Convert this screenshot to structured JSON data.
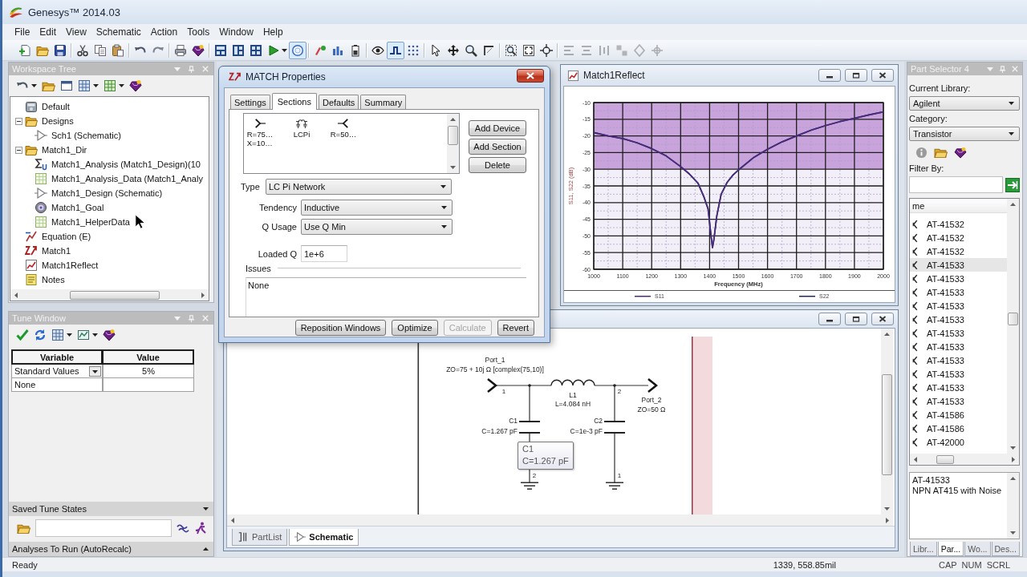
{
  "app": {
    "title": "Genesys™ 2014.03"
  },
  "menu": [
    "File",
    "Edit",
    "View",
    "Schematic",
    "Action",
    "Tools",
    "Window",
    "Help"
  ],
  "toolbar": {
    "toggle_buttons": [
      {
        "pressed": true
      },
      {
        "pressed": true
      }
    ],
    "arrange_buttons": {
      "disabled": true
    }
  },
  "workspace_tree": {
    "title": "Workspace Tree",
    "items": [
      {
        "label": "Default",
        "kind": "workspace"
      },
      {
        "label": "Designs",
        "kind": "folder",
        "expanded": true,
        "children": [
          {
            "label": "Sch1 (Schematic)",
            "kind": "schematic"
          }
        ]
      },
      {
        "label": "Match1_Dir",
        "kind": "folder",
        "expanded": true,
        "children": [
          {
            "label": "Match1_Analysis (Match1_Design)(10",
            "kind": "analysis"
          },
          {
            "label": "Match1_Analysis_Data (Match1_Analy",
            "kind": "dataset"
          },
          {
            "label": "Match1_Design (Schematic)",
            "kind": "schematic"
          },
          {
            "label": "Match1_Goal",
            "kind": "goal"
          },
          {
            "label": "Match1_HelperData",
            "kind": "dataset"
          }
        ]
      },
      {
        "label": "Equation (E)",
        "kind": "equation"
      },
      {
        "label": "Match1",
        "kind": "match"
      },
      {
        "label": "Match1Reflect",
        "kind": "graph"
      },
      {
        "label": "Notes",
        "kind": "notes"
      }
    ]
  },
  "tune_window": {
    "title": "Tune Window",
    "columns": [
      "Variable",
      "Value"
    ],
    "rows": [
      {
        "kind": "dropdown",
        "variable": "Standard Values",
        "value": "5%"
      },
      {
        "kind": "text",
        "variable": "None"
      }
    ]
  },
  "saved_tune_states": {
    "title": "Saved Tune States"
  },
  "analyses_to_run": {
    "title": "Analyses To Run (AutoRecalc)"
  },
  "match_properties": {
    "title": "MATCH Properties",
    "tabs": [
      {
        "label": "Settings",
        "selected": false
      },
      {
        "label": "Sections",
        "selected": true
      },
      {
        "label": "Defaults",
        "selected": false
      },
      {
        "label": "Summary",
        "selected": false
      }
    ],
    "sections": [
      {
        "kind": "source",
        "lines": [
          "R=75…",
          "X=10…"
        ]
      },
      {
        "kind": "network",
        "lines": [
          "LCPi"
        ]
      },
      {
        "kind": "load",
        "lines": [
          "R=50…"
        ]
      }
    ],
    "section_buttons": [
      {
        "label": "Add Device"
      },
      {
        "label": "Add Section"
      },
      {
        "label": "Delete"
      }
    ],
    "fields": [
      {
        "kind": "dropdown",
        "label": "Type",
        "value": "LC Pi Network"
      },
      {
        "kind": "dropdown",
        "label": "Tendency",
        "value": "Inductive"
      },
      {
        "kind": "dropdown",
        "label": "Q Usage",
        "value": "Use Q Min"
      },
      {
        "kind": "text",
        "label": "Loaded Q",
        "value": "1e+6"
      }
    ],
    "issues": {
      "label": "Issues",
      "text": "None"
    },
    "buttons": [
      {
        "label": "Reposition Windows",
        "disabled": false
      },
      {
        "label": "Optimize",
        "disabled": false
      },
      {
        "label": "Calculate",
        "disabled": true
      },
      {
        "label": "Revert",
        "disabled": false
      }
    ]
  },
  "reflect_window": {
    "title": "Match1Reflect",
    "chart_data": [
      {
        "type": "line",
        "xlabel": "Frequency (MHz)",
        "ylabel": "S11, S22 (dB)",
        "x": [
          1000,
          1050,
          1100,
          1150,
          1200,
          1250,
          1300,
          1330,
          1360,
          1380,
          1395,
          1405,
          1410,
          1415,
          1425,
          1440,
          1460,
          1480,
          1500,
          1550,
          1600,
          1650,
          1700,
          1750,
          1800,
          1850,
          1900,
          1950,
          2000
        ],
        "series": [
          {
            "name": "S11",
            "color": "#4a2c7c",
            "values": [
              -19,
              -20,
              -20.8,
              -22.1,
              -23.8,
              -26,
              -29.2,
              -31.4,
              -34.2,
              -38.2,
              -42,
              -50,
              -53.5,
              -51,
              -44,
              -37.5,
              -34,
              -31.8,
              -30.2,
              -26.6,
              -24,
              -21.8,
              -20,
              -18.3,
              -16.9,
              -15.7,
              -14.7,
              -13.7,
              -12.8
            ]
          },
          {
            "name": "S22",
            "color": "#22285c",
            "values": [
              -19,
              -20,
              -20.8,
              -22.1,
              -23.8,
              -26,
              -29.2,
              -31.4,
              -34.2,
              -38.2,
              -42,
              -50,
              -53.5,
              -51,
              -44,
              -37.5,
              -34,
              -31.8,
              -30.2,
              -26.6,
              -24,
              -21.8,
              -20,
              -18.3,
              -16.9,
              -15.7,
              -14.7,
              -13.7,
              -12.8
            ]
          }
        ],
        "xlim": [
          1000,
          2000
        ],
        "ylim": [
          -60,
          -10
        ],
        "xticks": [
          1000,
          1100,
          1200,
          1300,
          1400,
          1500,
          1600,
          1700,
          1800,
          1900,
          2000
        ],
        "yticks": [
          -60,
          -55,
          -50,
          -45,
          -40,
          -35,
          -30,
          -25,
          -20,
          -15,
          -10
        ],
        "bands": [
          {
            "axis": "y",
            "from": -30,
            "to": -10,
            "color": "#c9a3dc"
          }
        ],
        "grid": true,
        "legend": "bottom"
      }
    ]
  },
  "schematic_window": {
    "schematic": {
      "ports": [
        {
          "name": "Port_1",
          "impedance": "ZO=75 + 10j Ω [complex(75,10)]",
          "pin": "1"
        },
        {
          "name": "Port_2",
          "impedance": "ZO=50 Ω"
        }
      ],
      "components": [
        {
          "kind": "inductor",
          "name": "L1",
          "value": "L=4.084 nH",
          "pin": "2"
        },
        {
          "kind": "capacitor",
          "name": "C1",
          "value": "C=1.267 pF",
          "pin": "2"
        },
        {
          "kind": "capacitor",
          "name": "C2",
          "value": "C=1e-3 pF",
          "pin": "1"
        }
      ]
    },
    "tooltip": {
      "title": "C1",
      "text": "C=1.267 pF"
    },
    "tabs": [
      {
        "label": "PartList",
        "kind": "partlist",
        "selected": false
      },
      {
        "label": "Schematic",
        "kind": "schematic",
        "selected": true
      }
    ]
  },
  "part_selector": {
    "title": "Part Selector 4",
    "library": {
      "label": "Current Library:",
      "value": "Agilent"
    },
    "category": {
      "label": "Category:",
      "value": "Transistor"
    },
    "filter": {
      "label": "Filter By:"
    },
    "column": "me",
    "parts": [
      {
        "name": "AT-41532",
        "selected": false
      },
      {
        "name": "AT-41532",
        "selected": false
      },
      {
        "name": "AT-41532",
        "selected": false
      },
      {
        "name": "AT-41533",
        "selected": true
      },
      {
        "name": "AT-41533",
        "selected": false
      },
      {
        "name": "AT-41533",
        "selected": false
      },
      {
        "name": "AT-41533",
        "selected": false
      },
      {
        "name": "AT-41533",
        "selected": false
      },
      {
        "name": "AT-41533",
        "selected": false
      },
      {
        "name": "AT-41533",
        "selected": false
      },
      {
        "name": "AT-41533",
        "selected": false
      },
      {
        "name": "AT-41533",
        "selected": false
      },
      {
        "name": "AT-41533",
        "selected": false
      },
      {
        "name": "AT-41533",
        "selected": false
      },
      {
        "name": "AT-41586",
        "selected": false
      },
      {
        "name": "AT-41586",
        "selected": false
      },
      {
        "name": "AT-42000",
        "selected": false
      }
    ],
    "description": [
      "AT-41533",
      "NPN AT415 with Noise"
    ],
    "tabs": [
      {
        "label": "Libr...",
        "selected": false
      },
      {
        "label": "Par...",
        "selected": true
      },
      {
        "label": "Wo...",
        "selected": false
      },
      {
        "label": "Des...",
        "selected": false
      }
    ]
  },
  "status_bar": {
    "message": "Ready",
    "position": "1339, 558.85mil",
    "indicators": [
      "CAP",
      "NUM",
      "SCRL"
    ]
  }
}
